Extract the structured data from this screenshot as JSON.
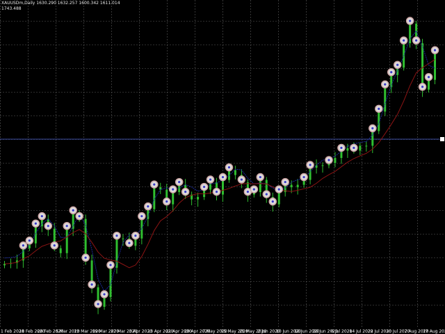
{
  "header": {
    "symbol_line": "XAUUSDm,Daily  1630.290 1632.257 1600.342 1611.014",
    "indicator_value": "1743.488"
  },
  "colors": {
    "background": "#000000",
    "grid": "#5a5a5a",
    "candle": "#2fbf2f",
    "ma_slow": "#8b1414",
    "ma_fast": "#1a2a9a",
    "horizontal_line": "#3a4aa0",
    "signal_marker_fill": "#dcdcdc",
    "signal_marker_ring": "#cfa7a7",
    "signal_marker_dot": "#3a3ac8"
  },
  "x_axis": {
    "labels": [
      "1 Feb 2020",
      "18 Feb 2020",
      "26 Feb 2020",
      "5 Mar 2020",
      "13 Mar 2020",
      "19 Mar 2020",
      "27 Mar 2020",
      "3 Apr 2020",
      "13 Apr 2020",
      "21 Apr 2020",
      "29 Apr 2020",
      "7 May 2020",
      "15 May 2020",
      "25 May 2020",
      "2 Jun 2020",
      "10 Jun 2020",
      "18 Jun 2020",
      "26 Jun 2020",
      "6 Jul 2020",
      "14 Jul 2020",
      "22 Jul 2020",
      "30 Jul 2020",
      "7 Aug 2020",
      "17 Aug 2020"
    ]
  },
  "chart_data": {
    "type": "line",
    "note_series": "close prices approximated from candlesticks",
    "x": [
      "2020-02-10",
      "2020-02-12",
      "2020-02-14",
      "2020-02-18",
      "2020-02-20",
      "2020-02-22",
      "2020-02-24",
      "2020-02-26",
      "2020-02-28",
      "2020-03-02",
      "2020-03-04",
      "2020-03-06",
      "2020-03-10",
      "2020-03-12",
      "2020-03-16",
      "2020-03-18",
      "2020-03-20",
      "2020-03-24",
      "2020-03-26",
      "2020-03-30",
      "2020-04-01",
      "2020-04-03",
      "2020-04-07",
      "2020-04-09",
      "2020-04-14",
      "2020-04-16",
      "2020-04-20",
      "2020-04-22",
      "2020-04-24",
      "2020-04-28",
      "2020-04-30",
      "2020-05-04",
      "2020-05-06",
      "2020-05-08",
      "2020-05-12",
      "2020-05-14",
      "2020-05-18",
      "2020-05-20",
      "2020-05-22",
      "2020-05-26",
      "2020-05-28",
      "2020-06-01",
      "2020-06-03",
      "2020-06-05",
      "2020-06-09",
      "2020-06-11",
      "2020-06-15",
      "2020-06-17",
      "2020-06-19",
      "2020-06-23",
      "2020-06-25",
      "2020-06-29",
      "2020-07-01",
      "2020-07-03",
      "2020-07-07",
      "2020-07-09",
      "2020-07-13",
      "2020-07-15",
      "2020-07-17",
      "2020-07-21",
      "2020-07-23",
      "2020-07-27",
      "2020-07-29",
      "2020-07-31",
      "2020-08-04",
      "2020-08-06",
      "2020-08-10",
      "2020-08-12",
      "2020-08-14",
      "2020-08-18"
    ],
    "series": [
      {
        "values": [
          1568,
          1570,
          1575,
          1600,
          1610,
          1645,
          1660,
          1640,
          1600,
          1590,
          1640,
          1672,
          1660,
          1575,
          1520,
          1480,
          1500,
          1560,
          1620,
          1620,
          1605,
          1620,
          1660,
          1680,
          1725,
          1720,
          1690,
          1715,
          1730,
          1710,
          1700,
          1705,
          1720,
          1735,
          1710,
          1740,
          1760,
          1750,
          1735,
          1710,
          1715,
          1740,
          1705,
          1690,
          1715,
          1730,
          1725,
          1730,
          1740,
          1765,
          1770,
          1770,
          1775,
          1785,
          1800,
          1805,
          1800,
          1810,
          1810,
          1840,
          1880,
          1930,
          1955,
          1970,
          2020,
          2060,
          2020,
          1925,
          1945,
          2000
        ]
      }
    ],
    "ylim": [
      1450,
      2100
    ]
  }
}
